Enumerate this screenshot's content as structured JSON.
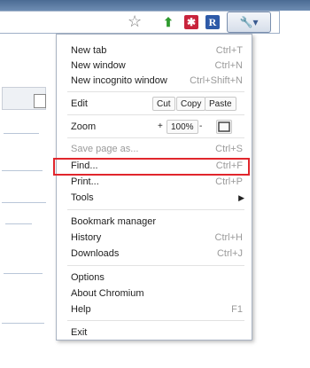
{
  "toolbar": {
    "star_glyph": "☆",
    "ext1_glyph": "⬆",
    "ext2_glyph": "✱",
    "ext3_glyph": "R",
    "wrench_glyph": "🔧▾"
  },
  "menu": {
    "new_tab": {
      "label": "New tab",
      "shortcut": "Ctrl+T"
    },
    "new_window": {
      "label": "New window",
      "shortcut": "Ctrl+N"
    },
    "new_incognito": {
      "label": "New incognito window",
      "shortcut": "Ctrl+Shift+N"
    },
    "edit": {
      "label": "Edit",
      "cut": "Cut",
      "copy": "Copy",
      "paste": "Paste"
    },
    "zoom": {
      "label": "Zoom",
      "plus": "+",
      "value": "100%",
      "minus": "-"
    },
    "save_page": {
      "label": "Save page as...",
      "shortcut": "Ctrl+S"
    },
    "find": {
      "label": "Find...",
      "shortcut": "Ctrl+F"
    },
    "print": {
      "label": "Print...",
      "shortcut": "Ctrl+P"
    },
    "tools": {
      "label": "Tools"
    },
    "bookmark_manager": {
      "label": "Bookmark manager"
    },
    "history": {
      "label": "History",
      "shortcut": "Ctrl+H"
    },
    "downloads": {
      "label": "Downloads",
      "shortcut": "Ctrl+J"
    },
    "options": {
      "label": "Options"
    },
    "about": {
      "label": "About Chromium"
    },
    "help": {
      "label": "Help",
      "shortcut": "F1"
    },
    "exit": {
      "label": "Exit"
    }
  },
  "colors": {
    "highlight": "#e1262c",
    "chrome": "#5a79a3"
  }
}
